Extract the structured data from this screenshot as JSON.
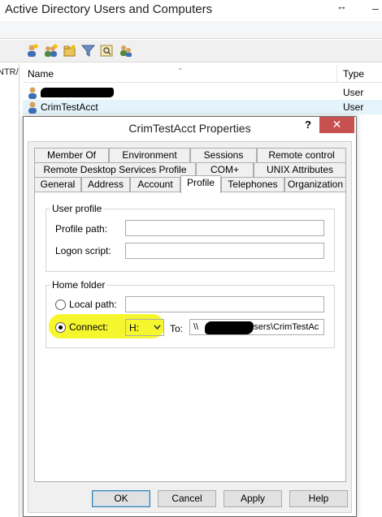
{
  "app": {
    "title": "Active Directory Users and Computers",
    "resize_glyph": "↔",
    "min_glyph": "–",
    "left_pane_fragment": "NTR/"
  },
  "toolbar": {
    "icons": [
      "user-icon",
      "group-icon",
      "ou-icon",
      "filter-icon",
      "find-icon",
      "delegate-icon"
    ]
  },
  "list": {
    "columns": {
      "name": "Name",
      "type": "Type"
    },
    "rows": [
      {
        "name": "",
        "type": "User",
        "redacted": true
      },
      {
        "name": "CrimTestAcct",
        "type": "User",
        "selected": true
      }
    ]
  },
  "dialog": {
    "title": "CrimTestAcct Properties",
    "help": "?",
    "close": "✕",
    "tabs_row1": [
      "Member Of",
      "Environment",
      "Sessions",
      "Remote control"
    ],
    "tabs_row2": [
      "Remote Desktop Services Profile",
      "COM+",
      "UNIX Attributes"
    ],
    "tabs_row3": [
      "General",
      "Address",
      "Account",
      "Profile",
      "Telephones",
      "Organization"
    ],
    "active_tab": "Profile",
    "user_profile": {
      "legend": "User profile",
      "profile_path_label": "Profile path:",
      "profile_path_value": "",
      "logon_script_label": "Logon script:",
      "logon_script_value": ""
    },
    "home_folder": {
      "legend": "Home folder",
      "local_path_label": "Local path:",
      "local_path_value": "",
      "local_path_checked": false,
      "connect_label": "Connect:",
      "connect_checked": true,
      "drive": "H:",
      "to_label": "To:",
      "to_value_prefix": "\\\\",
      "to_value_suffix": "users\\CrimTestAc"
    },
    "buttons": {
      "ok": "OK",
      "cancel": "Cancel",
      "apply": "Apply",
      "help": "Help"
    }
  },
  "colors": {
    "close": "#c75050",
    "highlight": "#f4f40a",
    "selected_row": "#e5f3fb"
  }
}
